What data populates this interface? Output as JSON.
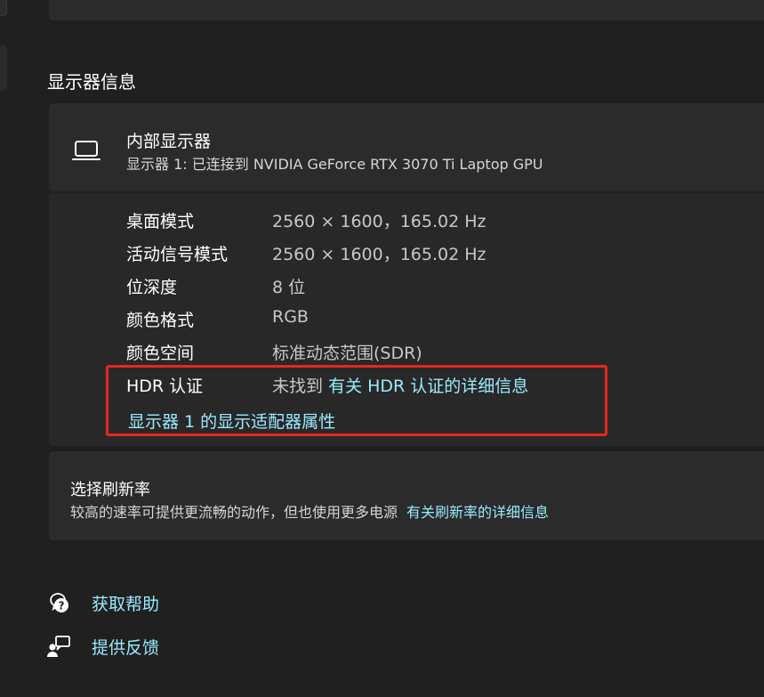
{
  "section": {
    "title": "显示器信息"
  },
  "display": {
    "icon": "laptop-icon",
    "title": "内部显示器",
    "subtitle": "显示器 1: 已连接到 NVIDIA GeForce RTX 3070 Ti Laptop GPU"
  },
  "details": [
    {
      "label": "桌面模式",
      "value": "2560 × 1600，165.02 Hz"
    },
    {
      "label": "活动信号模式",
      "value": "2560 × 1600，165.02 Hz"
    },
    {
      "label": "位深度",
      "value": "8 位"
    },
    {
      "label": "颜色格式",
      "value": "RGB"
    },
    {
      "label": "颜色空间",
      "value": "标准动态范围(SDR)"
    }
  ],
  "hdr": {
    "label": "HDR 认证",
    "value": "未找到",
    "link": "有关 HDR 认证的详细信息"
  },
  "adapter_link": "显示器 1 的显示适配器属性",
  "refresh": {
    "title": "选择刷新率",
    "description": "较高的速率可提供更流畅的动作，但也使用更多电源",
    "link": "有关刷新率的详细信息"
  },
  "help": [
    {
      "icon": "help-chat-icon",
      "label": "获取帮助"
    },
    {
      "icon": "feedback-icon",
      "label": "提供反馈"
    }
  ],
  "colors": {
    "background": "#202020",
    "card": "#2b2b2b",
    "link": "#99ebff",
    "highlight": "#e8261c"
  }
}
